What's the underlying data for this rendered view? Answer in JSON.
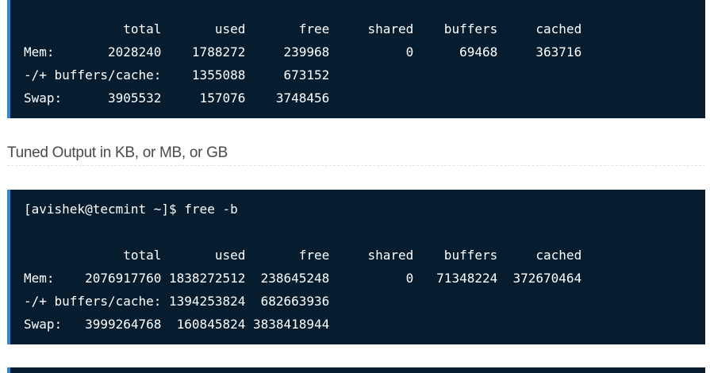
{
  "block1": {
    "lines": [
      "             total       used       free     shared    buffers     cached",
      "Mem:       2028240    1788272     239968          0      69468     363716",
      "-/+ buffers/cache:    1355088     673152",
      "Swap:      3905532     157076    3748456"
    ]
  },
  "section_heading": "Tuned Output in KB, or MB, or GB",
  "block2": {
    "lines": [
      "[avishek@tecmint ~]$ free -b",
      "",
      "             total       used       free     shared    buffers     cached",
      "Mem:    2076917760 1838272512  238645248          0   71348224  372670464",
      "-/+ buffers/cache: 1394253824  682663936",
      "Swap:   3999264768  160845824 3838418944"
    ]
  }
}
